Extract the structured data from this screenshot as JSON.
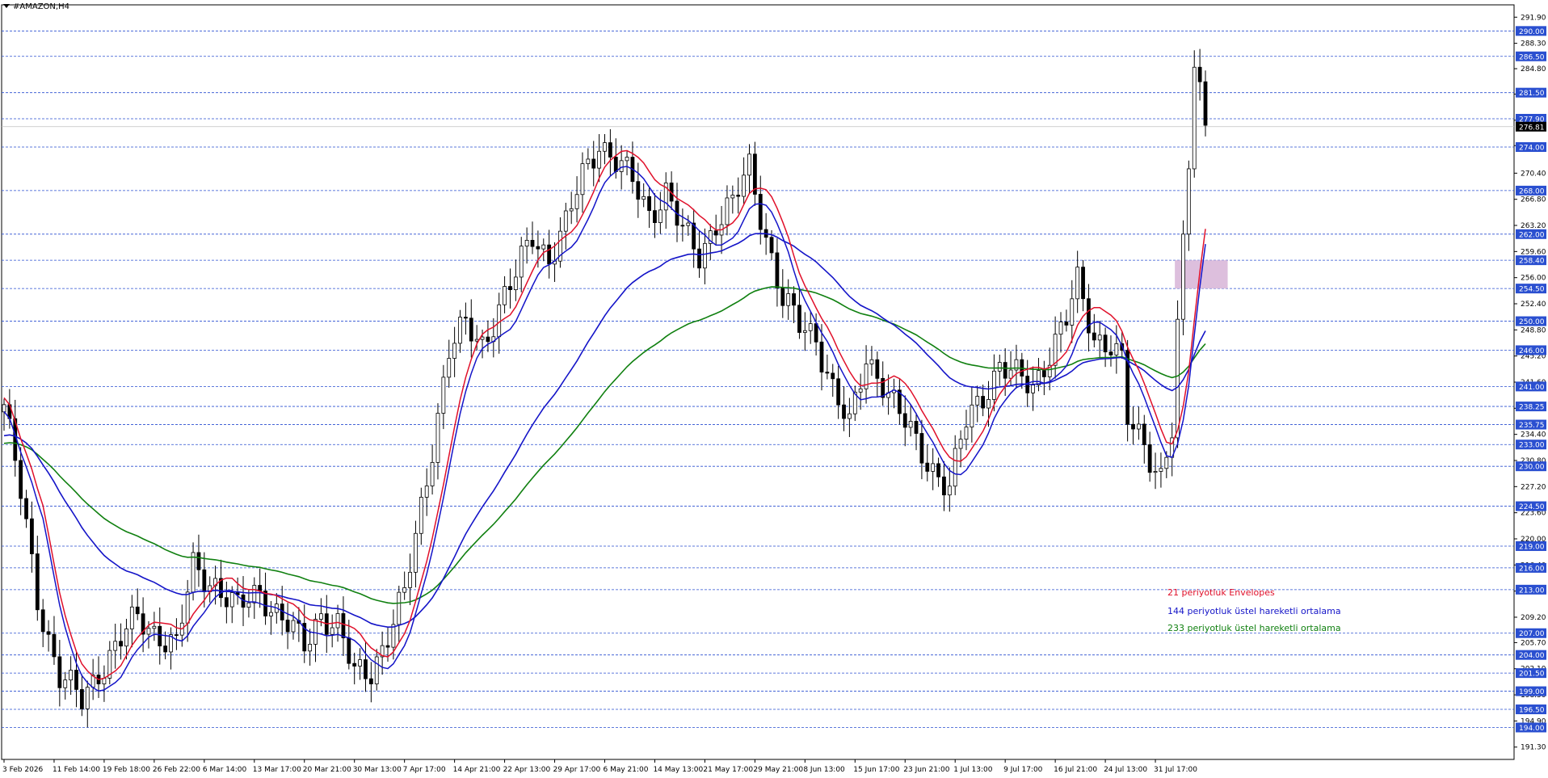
{
  "chart_title": "#AMAZON,H4",
  "chart_data": {
    "type": "candlestick",
    "symbol": "#AMAZON",
    "timeframe": "H4",
    "ylim": [
      189.6,
      293.6
    ],
    "y_ticks": [
      "291.90",
      "288.30",
      "284.80",
      "281.30",
      "277.70",
      "274.20",
      "270.40",
      "266.80",
      "263.20",
      "259.60",
      "256.00",
      "252.40",
      "248.80",
      "245.20",
      "241.60",
      "238.00",
      "234.40",
      "230.80",
      "227.20",
      "223.60",
      "220.00",
      "216.40",
      "212.80",
      "209.20",
      "205.70",
      "202.10",
      "198.50",
      "194.90",
      "191.30"
    ],
    "x_ticks": [
      "3 Feb 2026",
      "11 Feb 14:00",
      "19 Feb 18:00",
      "26 Feb 22:00",
      "6 Mar 14:00",
      "13 Mar 17:00",
      "20 Mar 21:00",
      "30 Mar 13:00",
      "7 Apr 17:00",
      "14 Apr 21:00",
      "22 Apr 13:00",
      "29 Apr 17:00",
      "6 May 21:00",
      "14 May 13:00",
      "21 May 17:00",
      "29 May 21:00",
      "8 Jun 13:00",
      "15 Jun 17:00",
      "23 Jun 21:00",
      "1 Jul 13:00",
      "9 Jul 17:00",
      "16 Jul 21:00",
      "24 Jul 13:00",
      "31 Jul 17:00"
    ],
    "horizontal_levels": [
      "290.00",
      "286.50",
      "281.50",
      "277.90",
      "274.00",
      "268.00",
      "262.00",
      "258.40",
      "254.50",
      "250.00",
      "246.00",
      "241.00",
      "238.25",
      "235.75",
      "233.00",
      "230.00",
      "224.50",
      "219.00",
      "216.00",
      "213.00",
      "207.00",
      "204.00",
      "201.50",
      "199.00",
      "196.50",
      "194.00"
    ],
    "current_price": "276.81",
    "zone": {
      "from": 254.5,
      "to": 258.4,
      "color": "#d9b8d9"
    },
    "close_path": [
      {
        "i": 0,
        "v": 238.5
      },
      {
        "i": 3,
        "v": 226
      },
      {
        "i": 6,
        "v": 212
      },
      {
        "i": 10,
        "v": 201
      },
      {
        "i": 14,
        "v": 197.5
      },
      {
        "i": 17,
        "v": 202
      },
      {
        "i": 20,
        "v": 205
      },
      {
        "i": 24,
        "v": 209
      },
      {
        "i": 28,
        "v": 207
      },
      {
        "i": 31,
        "v": 205
      },
      {
        "i": 34,
        "v": 216
      },
      {
        "i": 38,
        "v": 214
      },
      {
        "i": 42,
        "v": 210
      },
      {
        "i": 46,
        "v": 213
      },
      {
        "i": 50,
        "v": 209
      },
      {
        "i": 54,
        "v": 205
      },
      {
        "i": 57,
        "v": 210
      },
      {
        "i": 60,
        "v": 208
      },
      {
        "i": 63,
        "v": 201
      },
      {
        "i": 66,
        "v": 202
      },
      {
        "i": 69,
        "v": 207
      },
      {
        "i": 72,
        "v": 212
      },
      {
        "i": 74,
        "v": 220
      },
      {
        "i": 77,
        "v": 233
      },
      {
        "i": 80,
        "v": 246
      },
      {
        "i": 83,
        "v": 249
      },
      {
        "i": 86,
        "v": 247
      },
      {
        "i": 89,
        "v": 252
      },
      {
        "i": 92,
        "v": 256
      },
      {
        "i": 95,
        "v": 262
      },
      {
        "i": 98,
        "v": 259
      },
      {
        "i": 101,
        "v": 263
      },
      {
        "i": 104,
        "v": 270
      },
      {
        "i": 107,
        "v": 275
      },
      {
        "i": 110,
        "v": 272
      },
      {
        "i": 113,
        "v": 269
      },
      {
        "i": 116,
        "v": 265
      },
      {
        "i": 119,
        "v": 268
      },
      {
        "i": 122,
        "v": 262
      },
      {
        "i": 125,
        "v": 259
      },
      {
        "i": 128,
        "v": 264
      },
      {
        "i": 131,
        "v": 266
      },
      {
        "i": 134,
        "v": 271
      },
      {
        "i": 137,
        "v": 262
      },
      {
        "i": 140,
        "v": 253
      },
      {
        "i": 143,
        "v": 249
      },
      {
        "i": 146,
        "v": 248
      },
      {
        "i": 149,
        "v": 241
      },
      {
        "i": 152,
        "v": 235
      },
      {
        "i": 155,
        "v": 245
      },
      {
        "i": 158,
        "v": 242
      },
      {
        "i": 161,
        "v": 237
      },
      {
        "i": 164,
        "v": 233
      },
      {
        "i": 167,
        "v": 230
      },
      {
        "i": 170,
        "v": 227
      },
      {
        "i": 173,
        "v": 236
      },
      {
        "i": 176,
        "v": 240
      },
      {
        "i": 179,
        "v": 244
      },
      {
        "i": 182,
        "v": 242
      },
      {
        "i": 185,
        "v": 241
      },
      {
        "i": 188,
        "v": 246
      },
      {
        "i": 191,
        "v": 250
      },
      {
        "i": 193,
        "v": 255
      },
      {
        "i": 196,
        "v": 248
      },
      {
        "i": 199,
        "v": 247
      },
      {
        "i": 201,
        "v": 244
      },
      {
        "i": 202,
        "v": 236
      },
      {
        "i": 205,
        "v": 233
      },
      {
        "i": 208,
        "v": 229
      },
      {
        "i": 210,
        "v": 235
      },
      {
        "i": 212,
        "v": 262
      },
      {
        "i": 213,
        "v": 271
      },
      {
        "i": 214,
        "v": 285
      },
      {
        "i": 216,
        "v": 277
      }
    ],
    "series": [
      {
        "name": "21 periyotluk Envelopes",
        "color": "#e0102a"
      },
      {
        "name": "144 periyotluk üstel hareketli ortalama",
        "color": "#1414c8"
      },
      {
        "name": "233 periyotluk üstel hareketli ortalama",
        "color": "#108010"
      }
    ],
    "grid": false
  }
}
